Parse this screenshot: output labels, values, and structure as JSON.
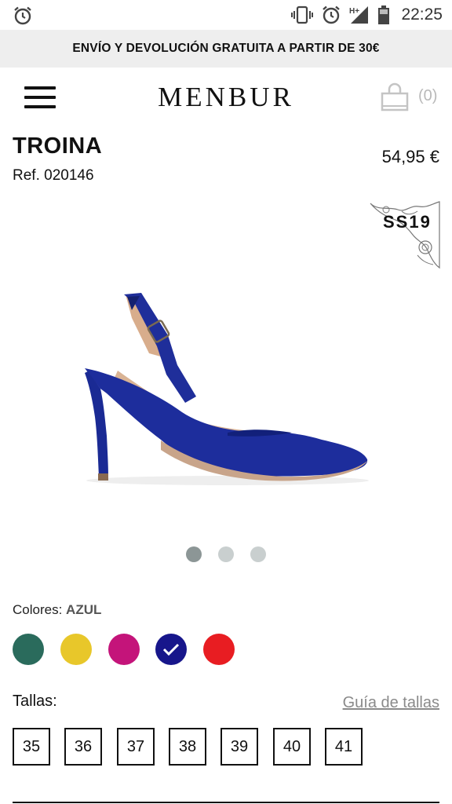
{
  "status_bar": {
    "time": "22:25",
    "icons": [
      "alarm-icon",
      "vibrate-icon",
      "alarm-icon",
      "signal-hplus-icon",
      "battery-icon"
    ],
    "network_label": "H+"
  },
  "promo_banner": {
    "text": "ENVÍO Y DEVOLUCIÓN GRATUITA A PARTIR DE 30€"
  },
  "header": {
    "logo": "MENBUR",
    "cart_count": "(0)",
    "icons": [
      "menu-icon",
      "shopping-bag-icon"
    ]
  },
  "product": {
    "name": "TROINA",
    "ref": "Ref. 020146",
    "price": "54,95 €",
    "season_badge": "SS19",
    "gallery": {
      "image_count": 3,
      "active_index": 0
    }
  },
  "colors": {
    "label": "Colores:",
    "selected_name": "AZUL",
    "swatches": [
      {
        "name": "green",
        "hex": "#2a6b5c",
        "selected": false
      },
      {
        "name": "yellow",
        "hex": "#e8c72a",
        "selected": false
      },
      {
        "name": "magenta",
        "hex": "#c4147a",
        "selected": false
      },
      {
        "name": "azul",
        "hex": "#17168b",
        "selected": true
      },
      {
        "name": "red",
        "hex": "#e81d22",
        "selected": false
      }
    ]
  },
  "sizes": {
    "label": "Tallas:",
    "guide_link": "Guía de tallas",
    "options": [
      "35",
      "36",
      "37",
      "38",
      "39",
      "40",
      "41"
    ]
  }
}
